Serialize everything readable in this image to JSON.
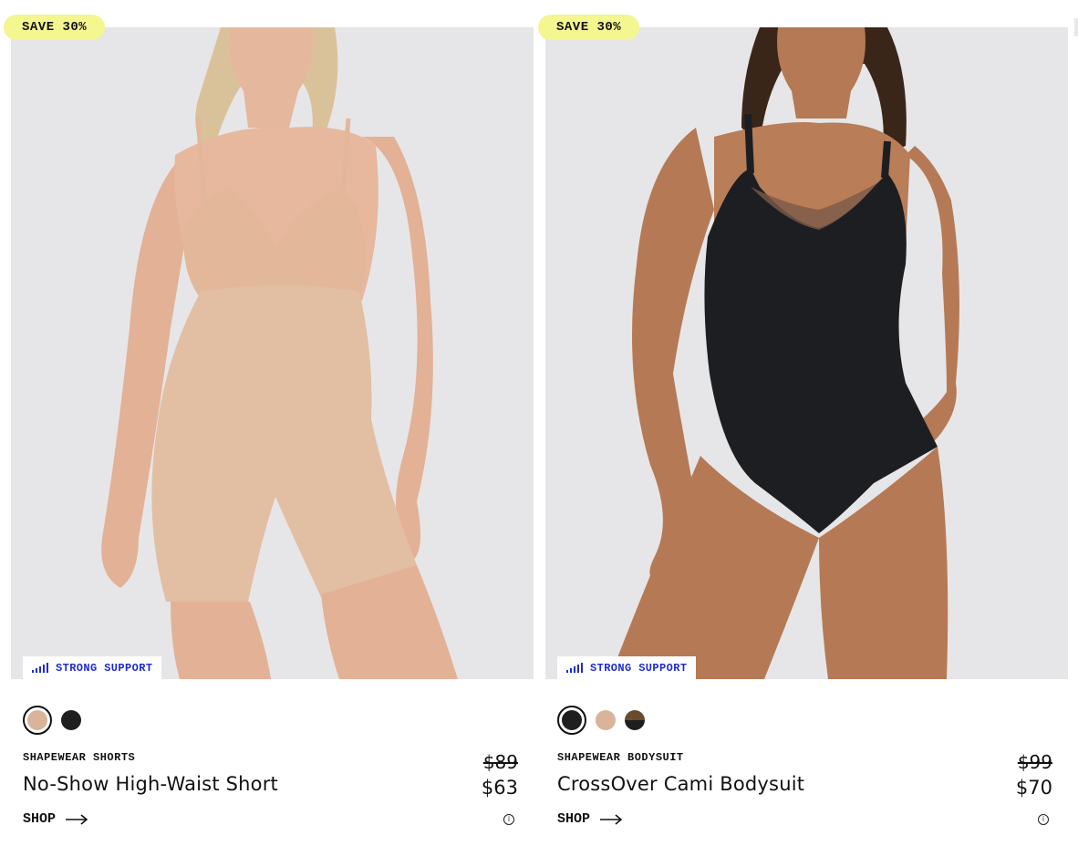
{
  "products": [
    {
      "badge": "SAVE 30%",
      "support": "STRONG SUPPORT",
      "category": "SHAPEWEAR SHORTS",
      "name": "No-Show High-Waist Short",
      "original_price": "$89",
      "price": "$63",
      "shop_label": "SHOP",
      "image_alt": "Model wearing beige shapewear short",
      "swatches": [
        {
          "color": "#d9b49a",
          "selected": true
        },
        {
          "color": "#1f1f1f",
          "selected": false
        }
      ]
    },
    {
      "badge": "SAVE 30%",
      "support": "STRONG SUPPORT",
      "category": "SHAPEWEAR BODYSUIT",
      "name": "CrossOver Cami Bodysuit",
      "original_price": "$99",
      "price": "$70",
      "shop_label": "SHOP",
      "image_alt": "Model wearing black cami bodysuit",
      "swatches": [
        {
          "color": "#1f1f1f",
          "selected": true
        },
        {
          "color": "#d9b49a",
          "selected": false
        },
        {
          "color": "split-brown-black",
          "selected": false
        }
      ]
    }
  ],
  "colors": {
    "badge_bg": "#f4f690",
    "support_text": "#1e2bd6",
    "image_bg": "#e6e6e8",
    "nude": "#d9b49a",
    "black": "#1f1f1f",
    "brown": "#6b4a2e"
  },
  "icons": {
    "support": "signal-bars-icon",
    "shop_arrow": "arrow-right-icon",
    "info": "info-icon"
  }
}
